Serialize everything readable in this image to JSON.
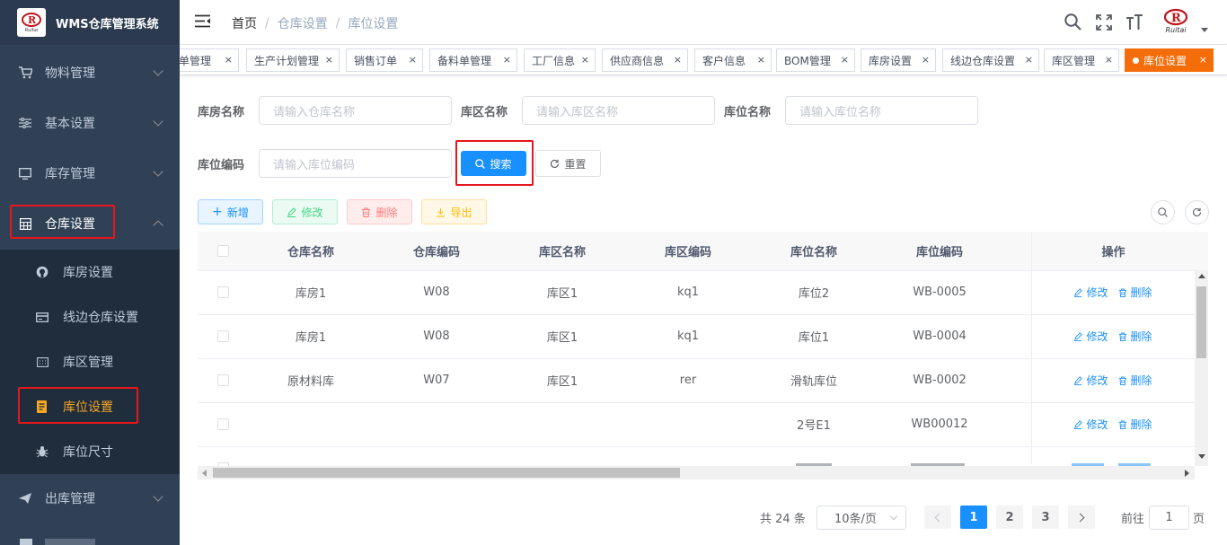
{
  "app": {
    "title": "WMS仓库管理系统",
    "logo_text": "Ruitai"
  },
  "sidebar": {
    "items": [
      {
        "label": "物料管理",
        "icon": "cart-icon"
      },
      {
        "label": "基本设置",
        "icon": "sliders-icon"
      },
      {
        "label": "库存管理",
        "icon": "monitor-icon"
      },
      {
        "label": "仓库设置",
        "icon": "grid-icon"
      },
      {
        "label": "出库管理",
        "icon": "plane-icon"
      }
    ],
    "subitems": [
      {
        "label": "库房设置",
        "icon": "github-icon"
      },
      {
        "label": "线边仓库设置",
        "icon": "card-icon"
      },
      {
        "label": "库区管理",
        "icon": "calendar-icon"
      },
      {
        "label": "库位设置",
        "icon": "list-icon"
      },
      {
        "label": "库位尺寸",
        "icon": "bug-icon"
      }
    ]
  },
  "breadcrumb": [
    "首页",
    "仓库设置",
    "库位设置"
  ],
  "tags": [
    "清单管理",
    "生产计划管理",
    "销售订单",
    "备料单管理",
    "工厂信息",
    "供应商信息",
    "客户信息",
    "BOM管理",
    "库房设置",
    "线边仓库设置",
    "库区管理",
    "库位设置"
  ],
  "tag_first_visible": "单管理",
  "filters": {
    "warehouse_label": "库房名称",
    "warehouse_ph": "请输入仓库名称",
    "zone_label": "库区名称",
    "zone_ph": "请输入库区名称",
    "location_label": "库位名称",
    "location_ph": "请输入库位名称",
    "code_label": "库位编码",
    "code_ph": "请输入库位编码",
    "search": "搜索",
    "reset": "重置"
  },
  "toolbar": {
    "add": "新增",
    "edit": "修改",
    "delete": "删除",
    "export": "导出"
  },
  "table": {
    "headers": [
      "仓库名称",
      "仓库编码",
      "库区名称",
      "库区编码",
      "库位名称",
      "库位编码",
      "操作"
    ],
    "rows": [
      [
        "库房1",
        "W08",
        "库区1",
        "kq1",
        "库位2",
        "WB-0005"
      ],
      [
        "库房1",
        "W08",
        "库区1",
        "kq1",
        "库位1",
        "WB-0004"
      ],
      [
        "原材料库",
        "W07",
        "库区1",
        "rer",
        "滑轨库位",
        "WB-0002"
      ],
      [
        "",
        "",
        "",
        "",
        "2号E1",
        "WB00012"
      ]
    ],
    "op_edit": "修改",
    "op_delete": "删除"
  },
  "pagination": {
    "total": "共 24 条",
    "page_size": "10条/页",
    "pages": [
      "1",
      "2",
      "3"
    ],
    "current": "1",
    "goto_label": "前往",
    "goto_value": "1",
    "page_unit": "页"
  },
  "colors": {
    "sidebar": "#304156",
    "submenu": "#1f2d3d",
    "accent": "#1890ff",
    "active_tag": "#f56c0a",
    "highlight": "#e8161b"
  }
}
